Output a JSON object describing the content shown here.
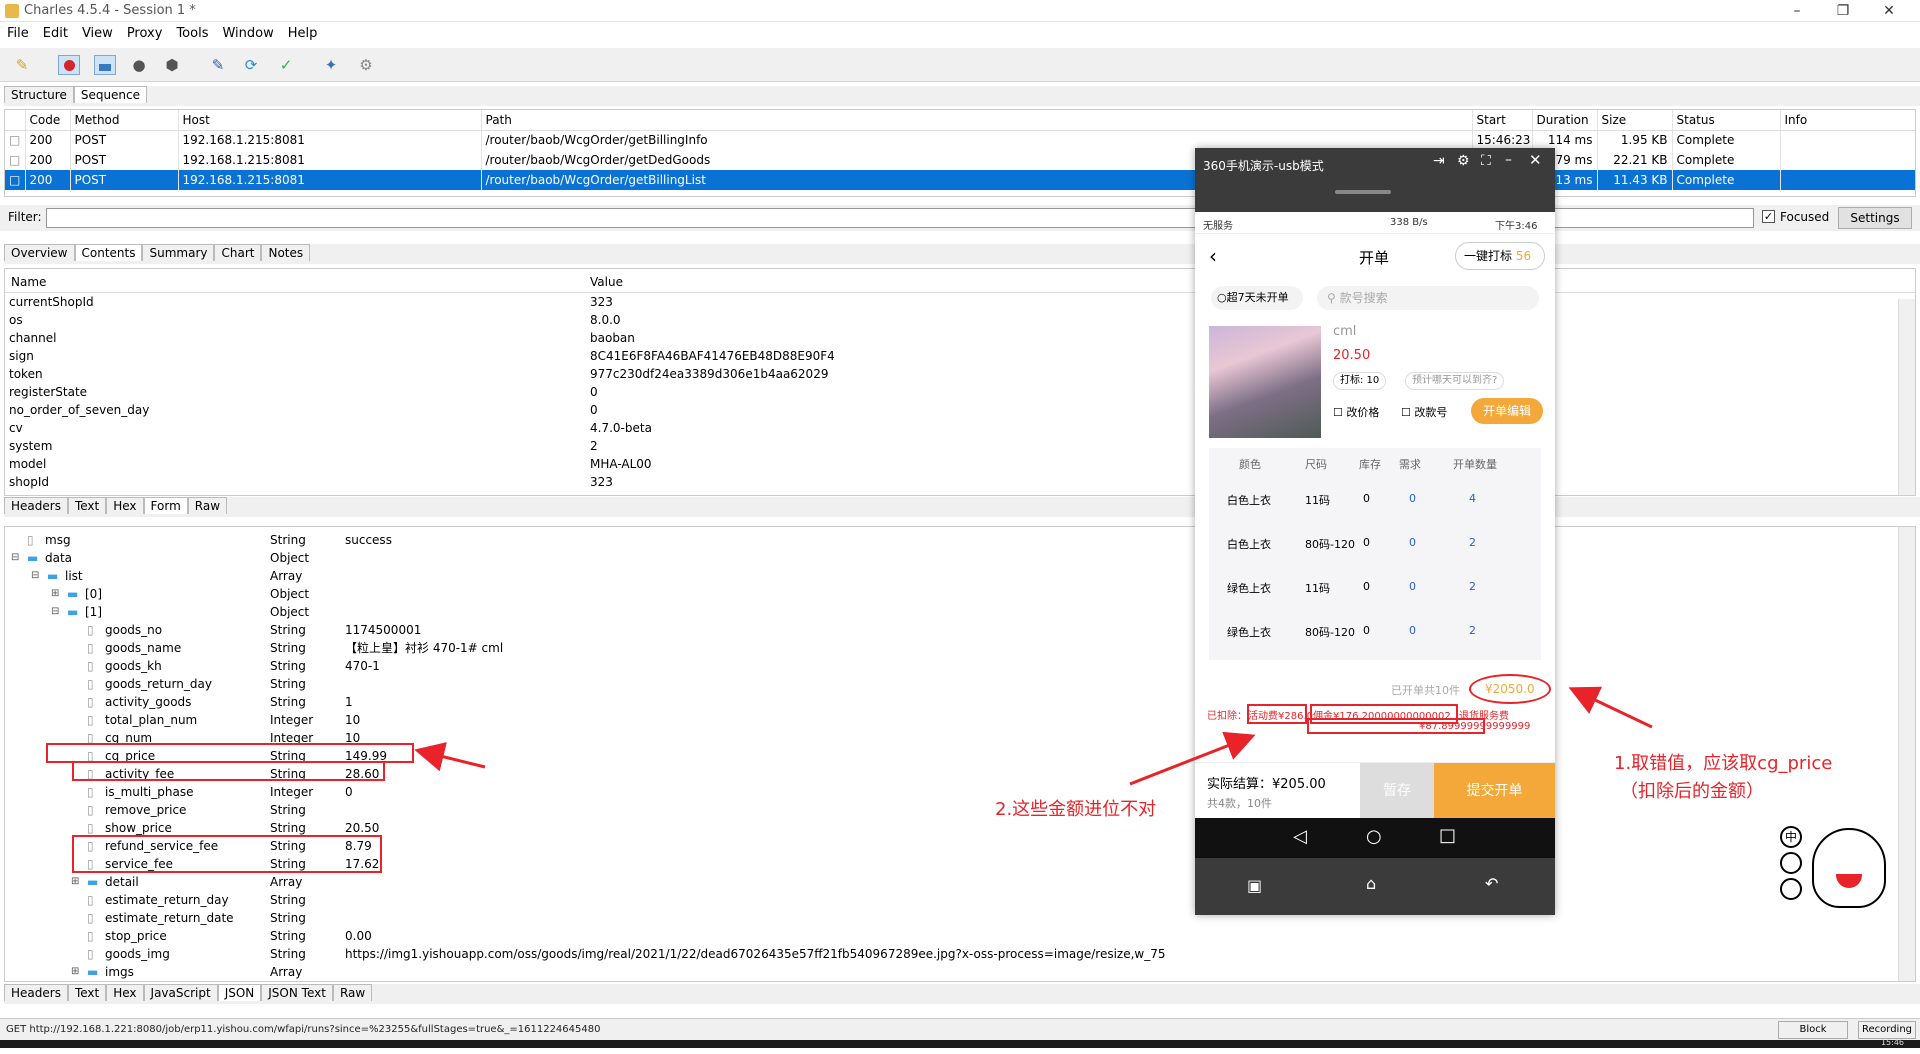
{
  "window": {
    "title": "Charles 4.5.4 - Session 1 *"
  },
  "menu": [
    "File",
    "Edit",
    "View",
    "Proxy",
    "Tools",
    "Window",
    "Help"
  ],
  "toolbar_icons": [
    "broom-icon",
    "record-icon",
    "throttle-icon",
    "turtle-icon",
    "stop-icon",
    "pen-icon",
    "refresh-icon",
    "check-icon",
    "tools-icon",
    "gear-icon"
  ],
  "view_tabs": [
    "Structure",
    "Sequence"
  ],
  "table": {
    "columns": [
      "Code",
      "Method",
      "Host",
      "Path",
      "Start",
      "Duration",
      "Size",
      "Status",
      "Info"
    ],
    "rows": [
      {
        "code": "200",
        "method": "POST",
        "host": "192.168.1.215:8081",
        "path": "/router/baob/WcgOrder/getBillingInfo",
        "start": "15:46:23",
        "duration": "114 ms",
        "size": "1.95 KB",
        "status": "Complete"
      },
      {
        "code": "200",
        "method": "POST",
        "host": "192.168.1.215:8081",
        "path": "/router/baob/WcgOrder/getDedGoods",
        "start": "",
        "duration": "79 ms",
        "size": "22.21 KB",
        "status": "Complete"
      },
      {
        "code": "200",
        "method": "POST",
        "host": "192.168.1.215:8081",
        "path": "/router/baob/WcgOrder/getBillingList",
        "start": "",
        "duration": "113 ms",
        "size": "11.43 KB",
        "status": "Complete"
      }
    ]
  },
  "filter": {
    "label": "Filter:",
    "focused_label": "Focused",
    "settings_label": "Settings"
  },
  "detail_tabs": [
    "Overview",
    "Contents",
    "Summary",
    "Chart",
    "Notes"
  ],
  "request_params": {
    "header_name": "Name",
    "header_value": "Value",
    "rows": [
      [
        "currentShopId",
        "323"
      ],
      [
        "os",
        "8.0.0"
      ],
      [
        "channel",
        "baoban"
      ],
      [
        "sign",
        "8C41E6F8FA46BAF41476EB48D88E90F4"
      ],
      [
        "token",
        "977c230df24ea3389d306e1b4aa62029"
      ],
      [
        "registerState",
        "0"
      ],
      [
        "no_order_of_seven_day",
        "0"
      ],
      [
        "cv",
        "4.7.0-beta"
      ],
      [
        "system",
        "2"
      ],
      [
        "model",
        "MHA-AL00"
      ],
      [
        "shopId",
        "323"
      ]
    ]
  },
  "request_tabs": [
    "Headers",
    "Text",
    "Hex",
    "Form",
    "Raw"
  ],
  "json_tree": [
    {
      "indent": 0,
      "name": "msg",
      "type": "String",
      "value": "success",
      "kind": "leaf"
    },
    {
      "indent": 0,
      "name": "data",
      "type": "Object",
      "value": "",
      "kind": "open"
    },
    {
      "indent": 1,
      "name": "list",
      "type": "Array",
      "value": "",
      "kind": "open"
    },
    {
      "indent": 2,
      "name": "[0]",
      "type": "Object",
      "value": "",
      "kind": "closed"
    },
    {
      "indent": 2,
      "name": "[1]",
      "type": "Object",
      "value": "",
      "kind": "open"
    },
    {
      "indent": 3,
      "name": "goods_no",
      "type": "String",
      "value": "1174500001",
      "kind": "leaf"
    },
    {
      "indent": 3,
      "name": "goods_name",
      "type": "String",
      "value": "【粒上皇】衬衫  470-1#  cml",
      "kind": "leaf"
    },
    {
      "indent": 3,
      "name": "goods_kh",
      "type": "String",
      "value": "470-1",
      "kind": "leaf"
    },
    {
      "indent": 3,
      "name": "goods_return_day",
      "type": "String",
      "value": "",
      "kind": "leaf"
    },
    {
      "indent": 3,
      "name": "activity_goods",
      "type": "String",
      "value": "1",
      "kind": "leaf"
    },
    {
      "indent": 3,
      "name": "total_plan_num",
      "type": "Integer",
      "value": "10",
      "kind": "leaf"
    },
    {
      "indent": 3,
      "name": "cg_num",
      "type": "Integer",
      "value": "10",
      "kind": "leaf"
    },
    {
      "indent": 3,
      "name": "cg_price",
      "type": "String",
      "value": "149.99",
      "kind": "leaf"
    },
    {
      "indent": 3,
      "name": "activity_fee",
      "type": "String",
      "value": "28.60",
      "kind": "leaf"
    },
    {
      "indent": 3,
      "name": "is_multi_phase",
      "type": "Integer",
      "value": "0",
      "kind": "leaf"
    },
    {
      "indent": 3,
      "name": "remove_price",
      "type": "String",
      "value": "",
      "kind": "leaf"
    },
    {
      "indent": 3,
      "name": "show_price",
      "type": "String",
      "value": "20.50",
      "kind": "leaf"
    },
    {
      "indent": 3,
      "name": "refund_service_fee",
      "type": "String",
      "value": "8.79",
      "kind": "leaf"
    },
    {
      "indent": 3,
      "name": "service_fee",
      "type": "String",
      "value": "17.62",
      "kind": "leaf"
    },
    {
      "indent": 3,
      "name": "detail",
      "type": "Array",
      "value": "",
      "kind": "closed"
    },
    {
      "indent": 3,
      "name": "estimate_return_day",
      "type": "String",
      "value": "",
      "kind": "leaf"
    },
    {
      "indent": 3,
      "name": "estimate_return_date",
      "type": "String",
      "value": "",
      "kind": "leaf"
    },
    {
      "indent": 3,
      "name": "stop_price",
      "type": "String",
      "value": "0.00",
      "kind": "leaf"
    },
    {
      "indent": 3,
      "name": "goods_img",
      "type": "String",
      "value": "https://img1.yishouapp.com/oss/goods/img/real/2021/1/22/dead67026435e57ff21fb540967289ee.jpg?x-oss-process=image/resize,w_75",
      "kind": "leaf"
    },
    {
      "indent": 3,
      "name": "imgs",
      "type": "Array",
      "value": "",
      "kind": "closed"
    }
  ],
  "response_tabs": [
    "Headers",
    "Text",
    "Hex",
    "JavaScript",
    "JSON",
    "JSON Text",
    "Raw"
  ],
  "statusbar": {
    "text": "GET http://192.168.1.221:8080/job/erp11.yishou.com/wfapi/runs?since=%23255&fullStages=true&_=1611224645480",
    "block_cookies": "Block Cookies",
    "recording": "Recording",
    "clock": "15:46"
  },
  "phone": {
    "window_title": "360手机演示-usb模式",
    "status_left": "无服务",
    "status_right": "338 B/s",
    "status_time": "下午3:46",
    "page_title": "开单",
    "one_click_label": "一键打标",
    "one_click_count": "56",
    "filter_chip": "超7天未开单",
    "search_placeholder": "款号搜索",
    "product": {
      "name": "cml",
      "price": "20.50",
      "tag": "打标: 10",
      "hint": "预计哪天可以到齐?",
      "option1": "改价格",
      "option2": "改款号",
      "edit_button": "开单编辑"
    },
    "table_headers": [
      "颜色",
      "尺码",
      "库存",
      "需求",
      "开单数量"
    ],
    "table_rows": [
      [
        "白色上衣",
        "11码",
        "0",
        "0",
        "4"
      ],
      [
        "白色上衣",
        "80码-120",
        "0",
        "0",
        "2"
      ],
      [
        "绿色上衣",
        "11码",
        "0",
        "0",
        "2"
      ],
      [
        "绿色上衣",
        "80码-120",
        "0",
        "0",
        "2"
      ]
    ],
    "summary_opened": "已开单共10件",
    "summary_total": "¥2050.0",
    "deduct_label": "已扣除：",
    "deduct_activity": "活动费¥286.0",
    "deduct_commission": "佣金¥176.20000000000002",
    "deduct_refund_label": "退货服务费",
    "deduct_refund_value": "¥87.89999999999999",
    "settle_label": "实际结算：¥205.00",
    "settle_sub": "共4款，10件",
    "save_button": "暂存",
    "submit_button": "提交开单"
  },
  "annotations": {
    "note1": "1.取错值，应该取cg_price",
    "note1b": "（扣除后的金额）",
    "note2": "2.这些金额进位不对"
  },
  "colors": {
    "selection": "#0a72d4",
    "annotation_red": "#e8232a",
    "phone_orange": "#f4a83a"
  }
}
